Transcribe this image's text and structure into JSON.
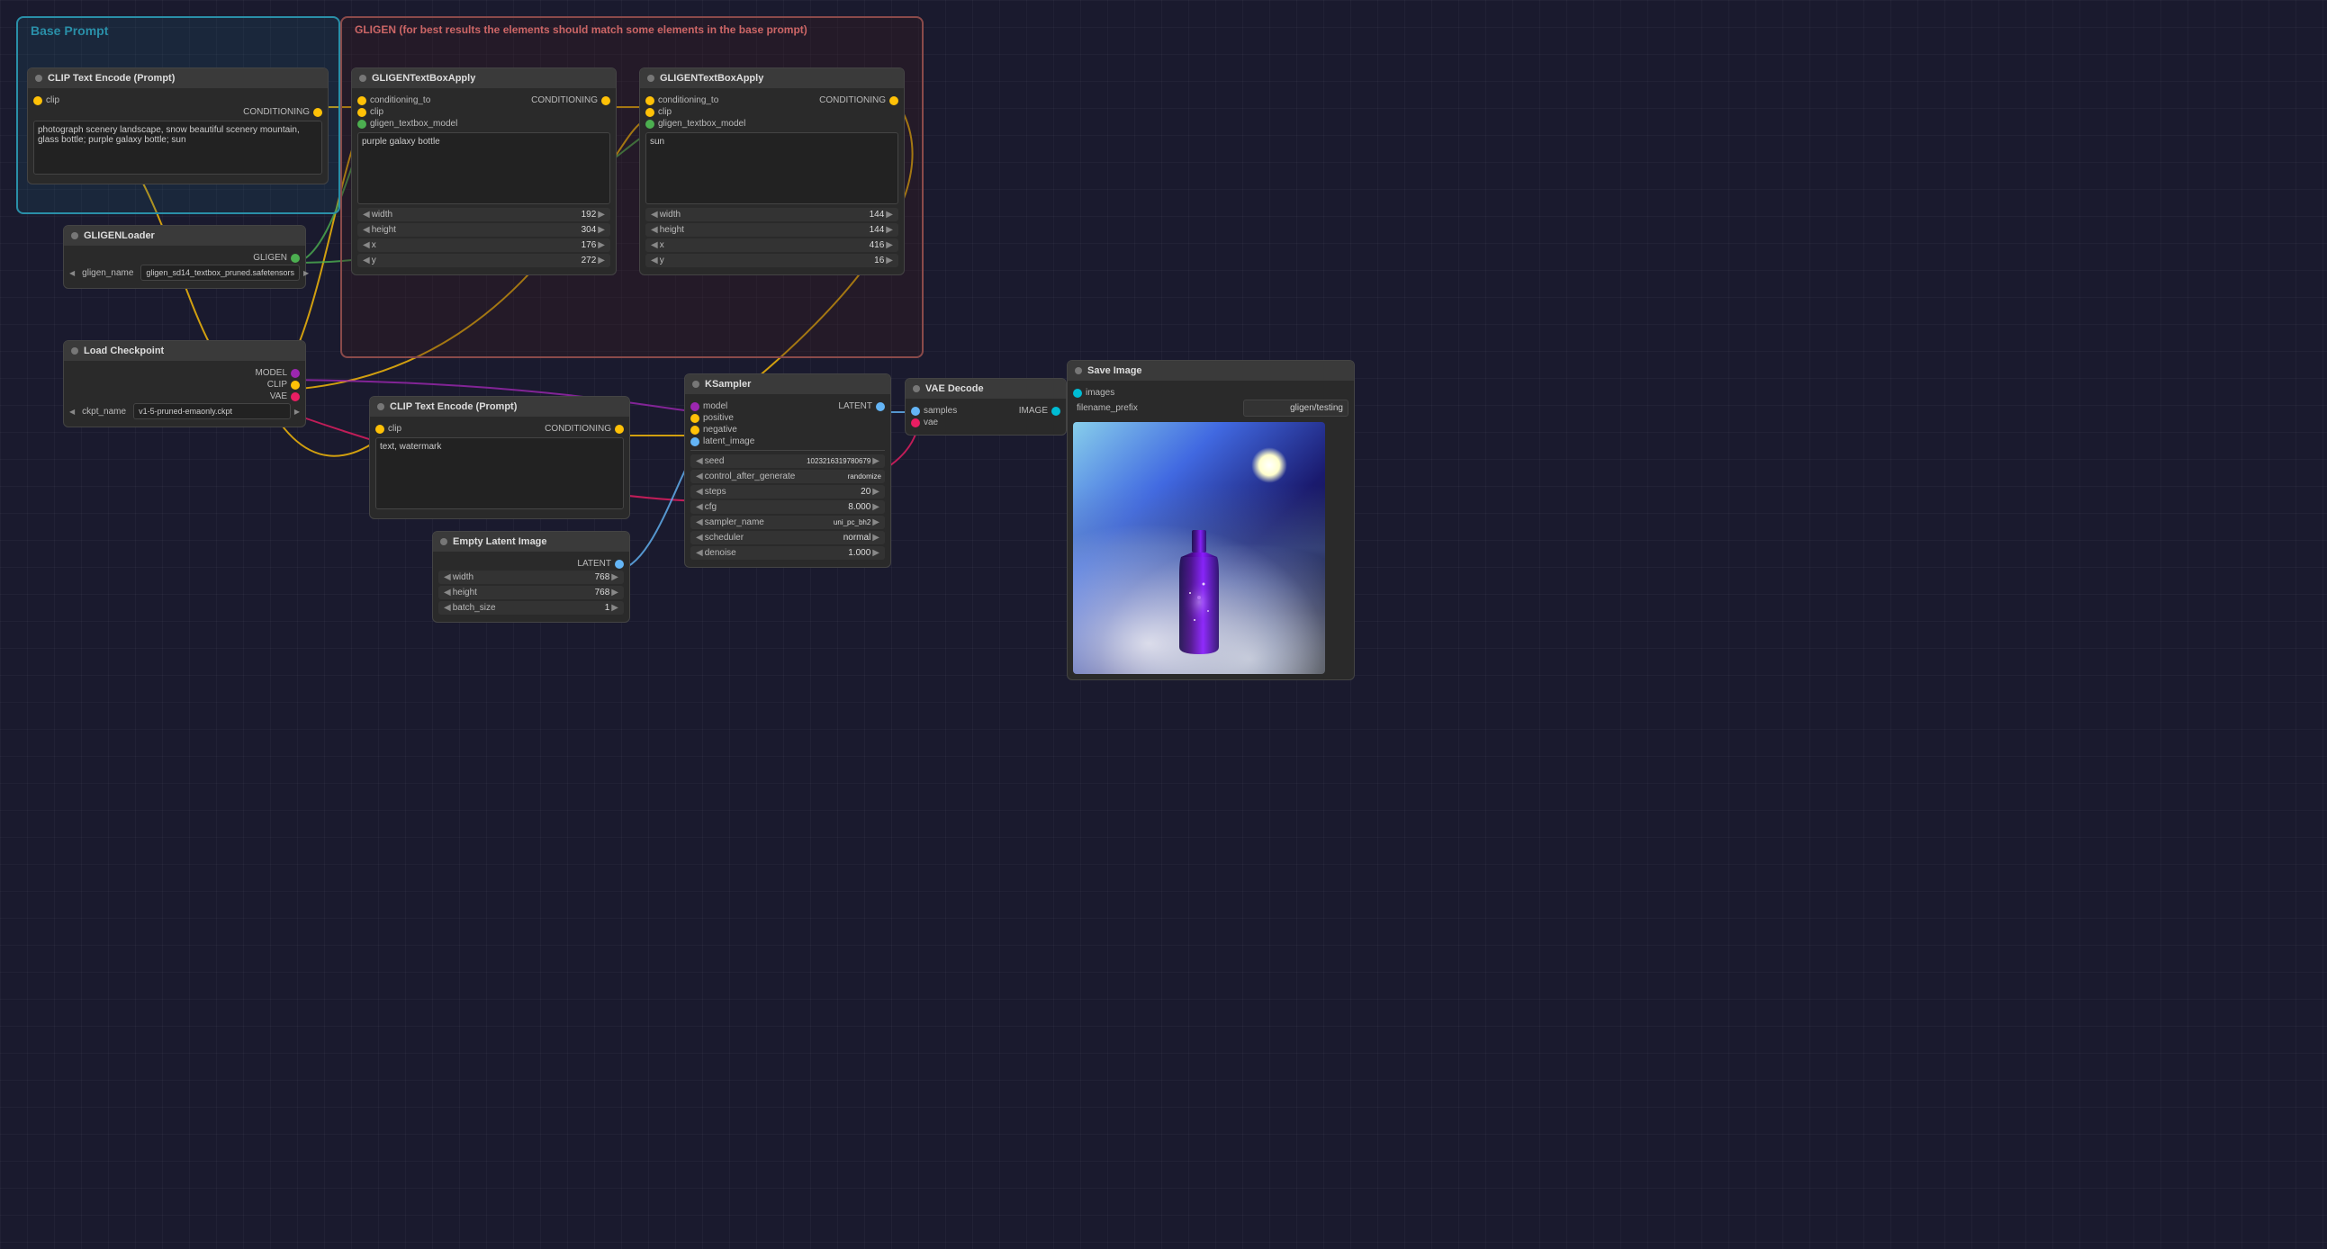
{
  "groups": {
    "base_prompt": {
      "label": "Base Prompt",
      "color": "#1e5f74",
      "border_color": "#2a8fa8"
    },
    "gligen": {
      "label": "GLIGEN (for best results the elements should match some elements in the base prompt)",
      "color": "#3a1a1a",
      "border_color": "#8a4a4a"
    }
  },
  "nodes": {
    "clip_text_encode_base": {
      "title": "CLIP Text Encode (Prompt)",
      "inputs": [
        {
          "label": "clip",
          "color": "yellow"
        }
      ],
      "outputs": [
        {
          "label": "CONDITIONING",
          "color": "yellow"
        }
      ],
      "text": "photograph scenery landscape, snow beautiful scenery mountain,\nglass bottle; purple galaxy bottle; sun"
    },
    "gligen_loader": {
      "title": "GLIGENLoader",
      "inputs": [
        {
          "label": "gligen_name",
          "color": "green"
        }
      ],
      "outputs": [
        {
          "label": "GLIGEN",
          "color": "green"
        }
      ],
      "select_val": "gligen_sd14_textbox_pruned.safetensors"
    },
    "load_checkpoint": {
      "title": "Load Checkpoint",
      "inputs": [
        {
          "label": "ckpt_name",
          "color": "orange"
        }
      ],
      "outputs": [
        {
          "label": "MODEL",
          "color": "purple"
        },
        {
          "label": "CLIP",
          "color": "yellow"
        },
        {
          "label": "VAE",
          "color": "pink"
        }
      ],
      "select_val": "v1-5-pruned-emaonly.ckpt"
    },
    "gligen_textbox_1": {
      "title": "GLIGENTextBoxApply",
      "inputs": [
        {
          "label": "conditioning_to",
          "color": "yellow"
        },
        {
          "label": "clip",
          "color": "yellow"
        },
        {
          "label": "gligen_textbox_model",
          "color": "green"
        }
      ],
      "outputs": [
        {
          "label": "CONDITIONING",
          "color": "yellow"
        }
      ],
      "text": "purple galaxy bottle",
      "sliders": [
        {
          "label": "width",
          "value": "192"
        },
        {
          "label": "height",
          "value": "304"
        },
        {
          "label": "x",
          "value": "176"
        },
        {
          "label": "y",
          "value": "272"
        }
      ]
    },
    "gligen_textbox_2": {
      "title": "GLIGENTextBoxApply",
      "inputs": [
        {
          "label": "conditioning_to",
          "color": "yellow"
        },
        {
          "label": "clip",
          "color": "yellow"
        },
        {
          "label": "gligen_textbox_model",
          "color": "green"
        }
      ],
      "outputs": [
        {
          "label": "CONDITIONING",
          "color": "yellow"
        }
      ],
      "text": "sun",
      "sliders": [
        {
          "label": "width",
          "value": "144"
        },
        {
          "label": "height",
          "value": "144"
        },
        {
          "label": "x",
          "value": "416"
        },
        {
          "label": "y",
          "value": "16"
        }
      ]
    },
    "clip_text_encode_neg": {
      "title": "CLIP Text Encode (Prompt)",
      "inputs": [
        {
          "label": "clip",
          "color": "yellow"
        }
      ],
      "outputs": [
        {
          "label": "CONDITIONING",
          "color": "yellow"
        }
      ],
      "text": "text, watermark"
    },
    "ksampler": {
      "title": "KSampler",
      "inputs": [
        {
          "label": "model",
          "color": "purple"
        },
        {
          "label": "positive",
          "color": "yellow"
        },
        {
          "label": "negative",
          "color": "yellow"
        },
        {
          "label": "latent_image",
          "color": "light-blue"
        }
      ],
      "outputs": [
        {
          "label": "LATENT",
          "color": "light-blue"
        }
      ],
      "params": [
        {
          "label": "seed",
          "value": "1023216319780679"
        },
        {
          "label": "control_after_generate",
          "value": "randomize"
        },
        {
          "label": "steps",
          "value": "20"
        },
        {
          "label": "cfg",
          "value": "8.000"
        },
        {
          "label": "sampler_name",
          "value": "uni_pc_bh2"
        },
        {
          "label": "scheduler",
          "value": "normal"
        },
        {
          "label": "denoise",
          "value": "1.000"
        }
      ]
    },
    "vae_decode": {
      "title": "VAE Decode",
      "inputs": [
        {
          "label": "samples",
          "color": "light-blue"
        },
        {
          "label": "vae",
          "color": "pink"
        }
      ],
      "outputs": [
        {
          "label": "IMAGE",
          "color": "cyan"
        }
      ]
    },
    "save_image": {
      "title": "Save Image",
      "inputs": [
        {
          "label": "images",
          "color": "cyan"
        }
      ],
      "outputs": [],
      "filename_prefix": "gligen/testing"
    },
    "empty_latent": {
      "title": "Empty Latent Image",
      "outputs": [
        {
          "label": "LATENT",
          "color": "light-blue"
        }
      ],
      "sliders": [
        {
          "label": "width",
          "value": "768"
        },
        {
          "label": "height",
          "value": "768"
        },
        {
          "label": "batch_size",
          "value": "1"
        }
      ]
    }
  }
}
